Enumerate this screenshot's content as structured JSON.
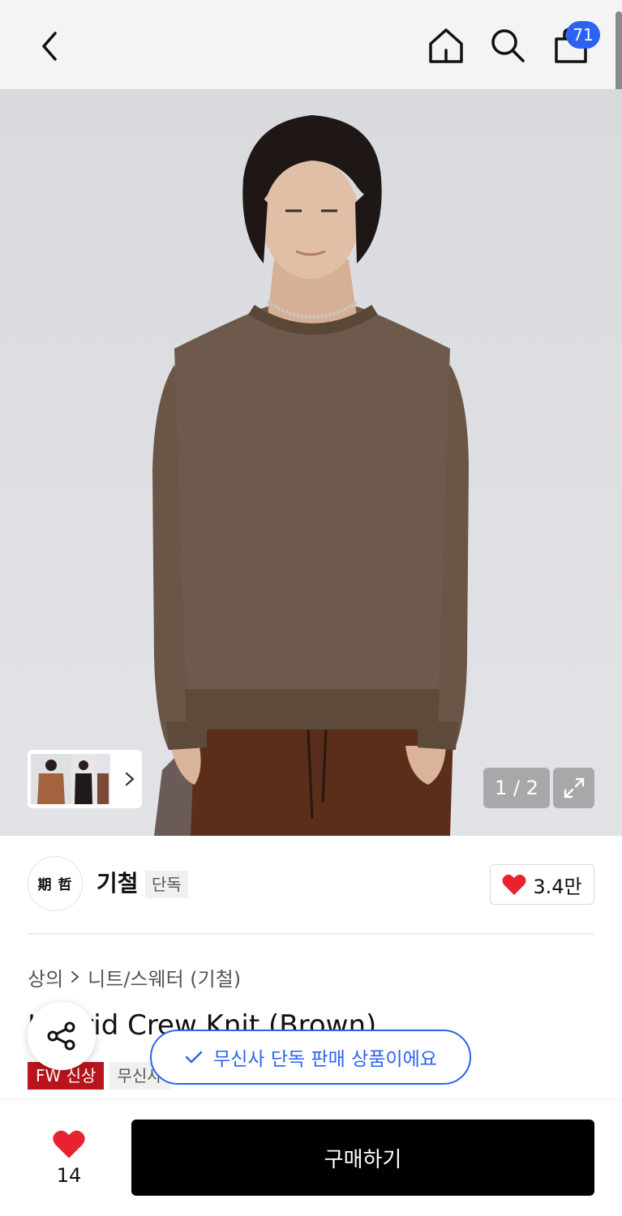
{
  "header": {
    "cart_count": "71"
  },
  "hero": {
    "page_counter": "1 / 2"
  },
  "brand": {
    "name": "기철",
    "exclusive_tag": "단독",
    "logo_text": "期 哲",
    "like_count": "3.4만"
  },
  "breadcrumb": {
    "category": "상의",
    "subcategory": "니트/스웨터 (기철)"
  },
  "product": {
    "title": "Hybrid Crew Knit (Brown)",
    "tags": [
      "FW 신상",
      "무신사"
    ]
  },
  "toast": {
    "message": "무신사 단독 판매 상품이에요"
  },
  "bottom": {
    "wish_count": "14",
    "buy_label": "구매하기"
  },
  "colors": {
    "accent_blue": "#2b62f0",
    "heart_red": "#e8222e",
    "tag_red": "#b9141c"
  }
}
